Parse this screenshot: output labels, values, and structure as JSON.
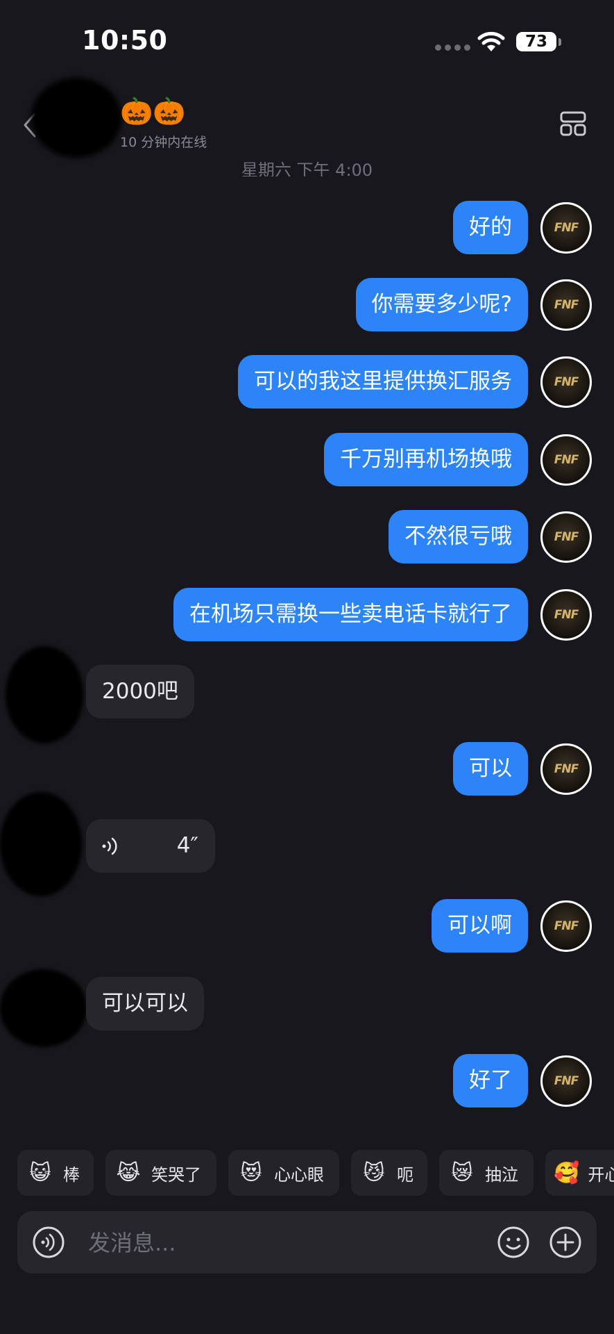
{
  "status_bar": {
    "time": "10:50",
    "battery": "73"
  },
  "header": {
    "emoji": "🎃🎃",
    "status": "10 分钟内在线"
  },
  "day_time": "星期六 下午 4:00",
  "self_avatar_label": "FNF",
  "messages": [
    {
      "dir": "out",
      "text": "好的"
    },
    {
      "dir": "out",
      "text": "你需要多少呢?"
    },
    {
      "dir": "out",
      "text": "可以的我这里提供换汇服务"
    },
    {
      "dir": "out",
      "text": "千万别再机场换哦"
    },
    {
      "dir": "out",
      "text": "不然很亏哦"
    },
    {
      "dir": "out",
      "text": "在机场只需换一些卖电话卡就行了"
    },
    {
      "dir": "in",
      "text": "2000吧"
    },
    {
      "dir": "out",
      "text": "可以"
    },
    {
      "dir": "in",
      "type": "voice",
      "duration": "4″"
    },
    {
      "dir": "out",
      "text": "可以啊"
    },
    {
      "dir": "in",
      "text": "可以可以"
    },
    {
      "dir": "out",
      "text": "好了"
    }
  ],
  "quick_emojis": [
    {
      "icon": "😺",
      "label": "棒"
    },
    {
      "icon": "😹",
      "label": "笑哭了"
    },
    {
      "icon": "😻",
      "label": "心心眼"
    },
    {
      "icon": "😼",
      "label": "呃"
    },
    {
      "icon": "😿",
      "label": "抽泣"
    },
    {
      "icon": "🥰",
      "label": "开心"
    }
  ],
  "composer": {
    "placeholder": "发消息..."
  }
}
